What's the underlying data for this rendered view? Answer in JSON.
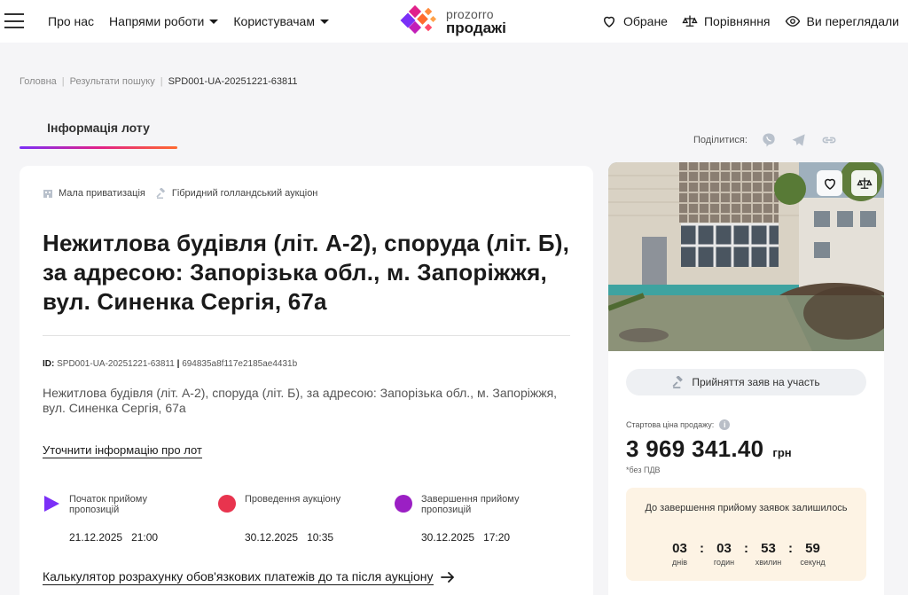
{
  "header": {
    "nav": [
      {
        "label": "Про нас",
        "has_caret": false
      },
      {
        "label": "Напрями роботи",
        "has_caret": true
      },
      {
        "label": "Користувачам",
        "has_caret": true
      }
    ],
    "logo": {
      "line1": "prozorro",
      "line2": "продажі"
    },
    "right": [
      {
        "label": "Обране",
        "icon": "heart-icon"
      },
      {
        "label": "Порівняння",
        "icon": "scales-icon"
      },
      {
        "label": "Ви переглядали",
        "icon": "eye-icon"
      }
    ]
  },
  "breadcrumb": {
    "home": "Головна",
    "search": "Результати пошуку",
    "current": "SPD001-UA-20251221-63811"
  },
  "tab": {
    "label": "Інформація лоту"
  },
  "share": {
    "label": "Поділитися:",
    "icons": [
      "viber-icon",
      "telegram-icon",
      "link-icon"
    ]
  },
  "lot": {
    "tags": [
      {
        "label": "Мала приватизація",
        "icon": "building-icon"
      },
      {
        "label": "Гібридний голландський аукціон",
        "icon": "gavel-icon"
      }
    ],
    "title": "Нежитлова будівля (літ. А-2), споруда (літ. Б), за адресою: Запорізька обл., м. Запоріжжя, вул. Синенка Сергія, 67а",
    "id_label": "ID:",
    "id_value": "SPD001-UA-20251221-63811",
    "hash": "694835a8f117e2185ae4431b",
    "description": "Нежитлова будівля (літ. А-2), споруда (літ. Б), за адресою: Запорізька обл., м. Запоріжжя, вул. Синенка Сергія, 67а",
    "clarify_link": "Уточнити інформацію про лот",
    "stages": [
      {
        "label": "Початок прийому пропозицій",
        "date": "21.12.2025",
        "time": "21:00",
        "color": "#7b2ff7",
        "marker": "play"
      },
      {
        "label": "Проведення аукціону",
        "date": "30.12.2025",
        "time": "10:35",
        "color": "#e8344e",
        "marker": "dot"
      },
      {
        "label": "Завершення прийому пропозицій",
        "date": "30.12.2025",
        "time": "17:20",
        "color": "#9b1fc4",
        "marker": "dot"
      }
    ],
    "calculator_link": "Калькулятор розрахунку обов'язкових платежів до та після аукціону"
  },
  "side": {
    "accept_button": "Прийняття заяв на участь",
    "start_price_label": "Стартова ціна продажу:",
    "price": "3 969 341.40",
    "currency": "грн",
    "vat_note": "*без ПДВ",
    "timer": {
      "title": "До завершення прийому заявок залишилось",
      "units": [
        {
          "value": "03",
          "label": "днів"
        },
        {
          "value": "03",
          "label": "годин"
        },
        {
          "value": "53",
          "label": "хвилин"
        },
        {
          "value": "59",
          "label": "секунд"
        }
      ]
    }
  }
}
